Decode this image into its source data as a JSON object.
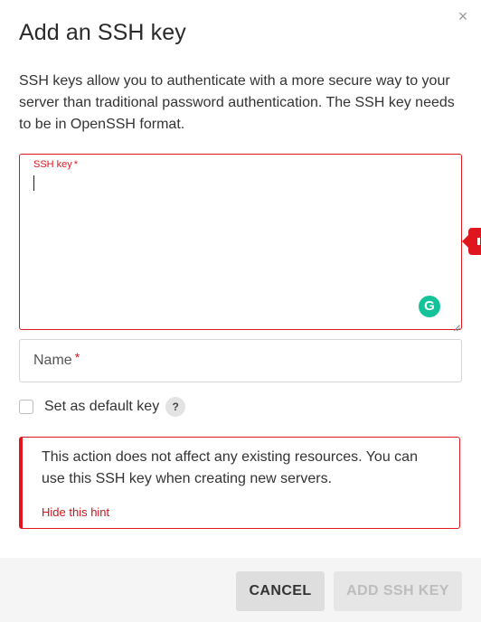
{
  "dialog": {
    "title": "Add an SSH key",
    "close_icon": "×",
    "description": "SSH keys allow you to authenticate with a more secure way to your server than traditional password authentication. The SSH key needs to be in OpenSSH format."
  },
  "ssh_key_field": {
    "label": "SSH key",
    "required_mark": "*",
    "value": "",
    "grammarly_icon": "G",
    "state": "error",
    "error_color": "#e0161e"
  },
  "name_field": {
    "label": "Name",
    "required_mark": "*",
    "value": ""
  },
  "default_key": {
    "label": "Set as default key",
    "checked": false,
    "help_icon": "?"
  },
  "hint": {
    "text": "This action does not affect any existing resources. You can use this SSH key when creating new servers.",
    "hide_link": "Hide this hint"
  },
  "footer": {
    "cancel_label": "CANCEL",
    "add_label": "ADD SSH KEY",
    "add_enabled": false
  },
  "colors": {
    "accent_red": "#e0161e",
    "grammarly_green": "#15c39a"
  }
}
